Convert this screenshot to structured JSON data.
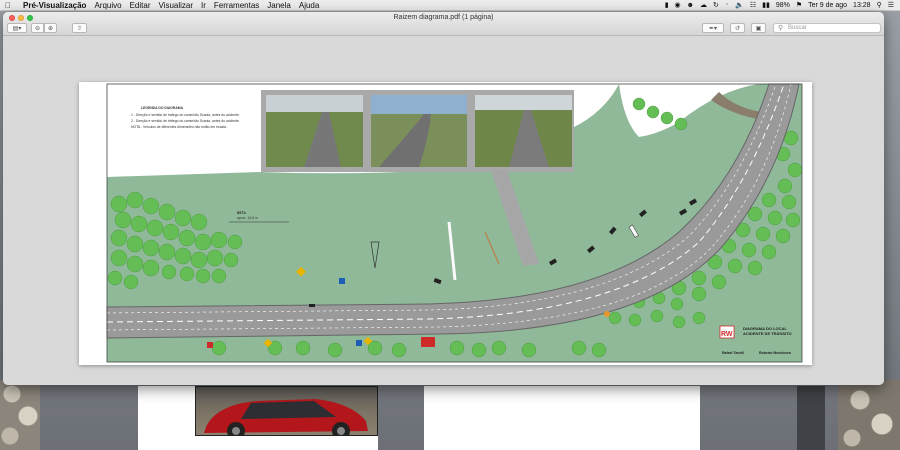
{
  "menubar": {
    "app_name": "Pré-Visualização",
    "items": [
      "Arquivo",
      "Editar",
      "Visualizar",
      "Ir",
      "Ferramentas",
      "Janela",
      "Ajuda"
    ],
    "battery": "98%",
    "date": "Ter 9 de ago",
    "time": "13:28"
  },
  "window": {
    "title": "Raizem diagrama.pdf (1 página)",
    "search_placeholder": "Buscar"
  },
  "diagram": {
    "legend_title": "LEGENDA DO DIAGRAMA",
    "legend_lines": [
      "1 - Direção e sentido de tráfego do caminhão Scania, antes do acidente.",
      "2 - Direção e sentido de tráfego do caminhão Scania, antes do acidente.",
      "NOTA - Veículos de diferentes dimensões não estão em escala."
    ],
    "distance_label": "BETA",
    "distance_value": "aprox. 14,5 m",
    "company_logo": "RW",
    "title_line1": "DIAGRAMA DO LOCAL",
    "title_line2": "ACIDENTE DE TRÂNSITO",
    "author1": "Rafael Tavelli",
    "author2": "Roberto Mendonca"
  },
  "colors": {
    "grass": "#8fb999",
    "road": "#9a9a9a",
    "tree": "#64bd55",
    "accent_red": "#cf2a2a"
  }
}
